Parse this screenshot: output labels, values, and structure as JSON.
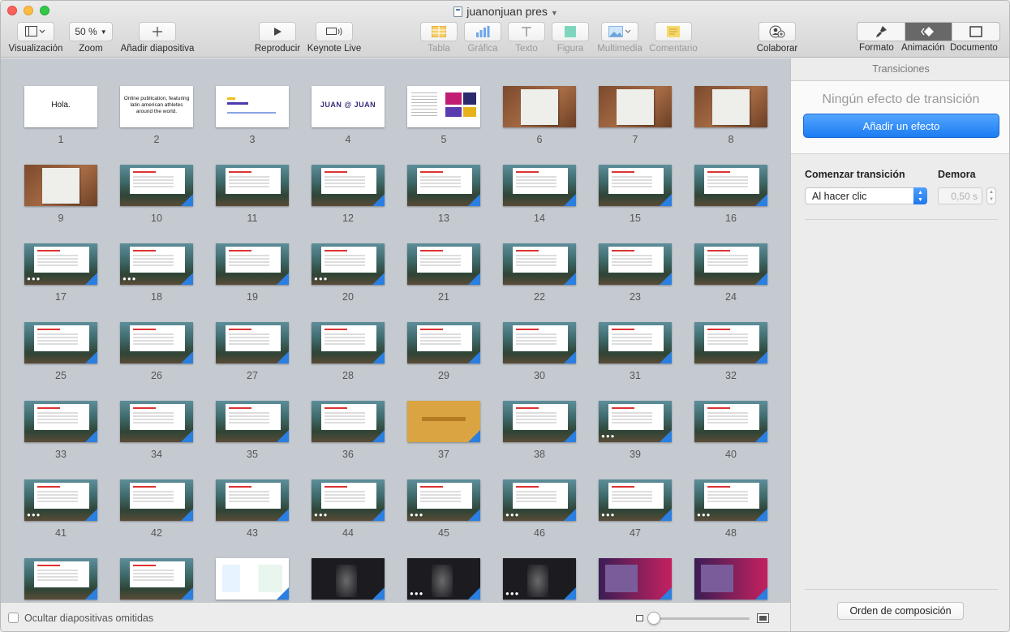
{
  "window": {
    "title": "juanonjuan pres"
  },
  "toolbar": {
    "view_label": "Visualización",
    "zoom_value": "50 %",
    "zoom_label": "Zoom",
    "add_slide_label": "Añadir diapositiva",
    "play_label": "Reproducir",
    "keynote_live_label": "Keynote Live",
    "table_label": "Tabla",
    "chart_label": "Gráfica",
    "text_label": "Texto",
    "shape_label": "Figura",
    "media_label": "Multimedia",
    "comment_label": "Comentario",
    "collaborate_label": "Colaborar",
    "format_label": "Formato",
    "animate_label": "Animación",
    "document_label": "Documento"
  },
  "slides": [
    {
      "n": "1",
      "kind": "text",
      "text": "Hola."
    },
    {
      "n": "2",
      "kind": "text",
      "text": "Online publication, featuring latin american athletes around the world."
    },
    {
      "n": "3",
      "kind": "brand"
    },
    {
      "n": "4",
      "kind": "logo",
      "text": "JUAN @ JUAN"
    },
    {
      "n": "5",
      "kind": "mood"
    },
    {
      "n": "6",
      "kind": "wood"
    },
    {
      "n": "7",
      "kind": "wood"
    },
    {
      "n": "8",
      "kind": "wood"
    },
    {
      "n": "9",
      "kind": "wood"
    },
    {
      "n": "10",
      "kind": "photo",
      "anim": true
    },
    {
      "n": "11",
      "kind": "photo"
    },
    {
      "n": "12",
      "kind": "photo",
      "anim": true
    },
    {
      "n": "13",
      "kind": "photo",
      "anim": true
    },
    {
      "n": "14",
      "kind": "photo",
      "anim": true
    },
    {
      "n": "15",
      "kind": "photo",
      "anim": true
    },
    {
      "n": "16",
      "kind": "photo",
      "anim": true
    },
    {
      "n": "17",
      "kind": "photo",
      "build": true,
      "anim": true
    },
    {
      "n": "18",
      "kind": "photo",
      "build": true,
      "anim": true
    },
    {
      "n": "19",
      "kind": "photo",
      "anim": true
    },
    {
      "n": "20",
      "kind": "photo",
      "build": true,
      "anim": true
    },
    {
      "n": "21",
      "kind": "photo",
      "anim": true
    },
    {
      "n": "22",
      "kind": "photo",
      "anim": true
    },
    {
      "n": "23",
      "kind": "photo",
      "anim": true
    },
    {
      "n": "24",
      "kind": "photo",
      "anim": true
    },
    {
      "n": "25",
      "kind": "photo",
      "anim": true
    },
    {
      "n": "26",
      "kind": "photo",
      "anim": true
    },
    {
      "n": "27",
      "kind": "photo",
      "anim": true
    },
    {
      "n": "28",
      "kind": "photo",
      "anim": true
    },
    {
      "n": "29",
      "kind": "photo",
      "anim": true
    },
    {
      "n": "30",
      "kind": "photo",
      "anim": true
    },
    {
      "n": "31",
      "kind": "photo",
      "anim": true
    },
    {
      "n": "32",
      "kind": "photo",
      "anim": true
    },
    {
      "n": "33",
      "kind": "photo",
      "anim": true
    },
    {
      "n": "34",
      "kind": "photo",
      "anim": true
    },
    {
      "n": "35",
      "kind": "photo",
      "anim": true
    },
    {
      "n": "36",
      "kind": "photo",
      "anim": true
    },
    {
      "n": "37",
      "kind": "gold",
      "anim": true
    },
    {
      "n": "38",
      "kind": "photo",
      "anim": true
    },
    {
      "n": "39",
      "kind": "photo",
      "build": true,
      "anim": true
    },
    {
      "n": "40",
      "kind": "photo",
      "anim": true
    },
    {
      "n": "41",
      "kind": "photo",
      "build": true,
      "anim": true
    },
    {
      "n": "42",
      "kind": "photo",
      "anim": true
    },
    {
      "n": "43",
      "kind": "photo",
      "anim": true
    },
    {
      "n": "44",
      "kind": "photo",
      "build": true,
      "anim": true
    },
    {
      "n": "45",
      "kind": "photo",
      "build": true,
      "anim": true
    },
    {
      "n": "46",
      "kind": "photo",
      "build": true,
      "anim": true
    },
    {
      "n": "47",
      "kind": "photo",
      "build": true,
      "anim": true
    },
    {
      "n": "48",
      "kind": "photo",
      "build": true,
      "anim": true
    },
    {
      "n": "",
      "kind": "photo",
      "anim": true
    },
    {
      "n": "",
      "kind": "photo",
      "anim": true
    },
    {
      "n": "",
      "kind": "cards",
      "anim": true
    },
    {
      "n": "",
      "kind": "dark",
      "anim": true
    },
    {
      "n": "",
      "kind": "dark",
      "build": true,
      "anim": true
    },
    {
      "n": "",
      "kind": "dark",
      "build": true,
      "anim": true
    },
    {
      "n": "",
      "kind": "purple",
      "anim": true
    },
    {
      "n": "",
      "kind": "purple",
      "anim": true
    }
  ],
  "footer": {
    "hide_skipped_label": "Ocultar diapositivas omitidas"
  },
  "panel": {
    "header": "Transiciones",
    "no_effect_text": "Ningún efecto de transición",
    "add_effect_label": "Añadir un efecto",
    "start_label": "Comenzar transición",
    "start_value": "Al hacer clic",
    "delay_label": "Demora",
    "delay_value": "0,50 s",
    "composition_label": "Orden de composición"
  },
  "colors": {
    "accent": "#1c7cf2",
    "sorter_bg": "#c5cad1",
    "animation_marker": "#2a7fe0"
  }
}
